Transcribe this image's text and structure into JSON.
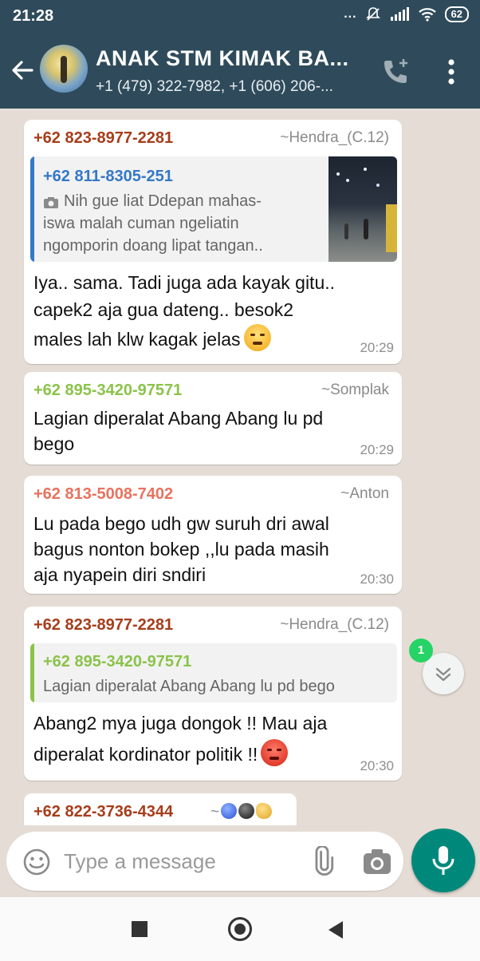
{
  "status_bar": {
    "time": "21:28",
    "signal_dots": "...",
    "battery": "62",
    "icons": [
      "mute-icon",
      "signal-icon",
      "wifi-icon",
      "battery-icon"
    ]
  },
  "header": {
    "title": "ANAK STM KIMAK BA...",
    "subtitle": "+1 (479) 322-7982, +1 (606) 206-...",
    "icons": [
      "back-arrow-icon",
      "group-avatar",
      "add-call-icon",
      "more-vert-icon"
    ]
  },
  "messages": [
    {
      "sender": "+62 823-8977-2281",
      "sender_color": "#a63d1b",
      "push_name": "~Hendra_(C.12)",
      "quote": {
        "sender": "+62 811-8305-251",
        "sender_color": "#3478c6",
        "lines": [
          "Nih gue liat Ddepan mahas-",
          "iswa malah cuman ngeliatin",
          "ngomporin doang lipat tangan.."
        ],
        "icon": "camera-icon",
        "has_thumbnail": true
      },
      "lines": [
        "Iya.. sama. Tadi juga ada kayak gitu..",
        "capek2 aja gua dateng.. besok2",
        "males lah klw kagak jelas"
      ],
      "emoji": "face-with-steam-emoji",
      "time": "20:29"
    },
    {
      "sender": "+62 895-3420-97571",
      "sender_color": "#8bc34a",
      "push_name": "~Somplak",
      "lines": [
        "Lagian diperalat Abang Abang lu pd",
        "bego"
      ],
      "time": "20:29"
    },
    {
      "sender": "+62 813-5008-7402",
      "sender_color": "#e8725e",
      "push_name": "~Anton",
      "lines": [
        "Lu pada bego udh gw suruh dri awal",
        "bagus nonton bokep ,,lu pada masih",
        "aja nyapein diri sndiri"
      ],
      "time": "20:30"
    },
    {
      "sender": "+62 823-8977-2281",
      "sender_color": "#a63d1b",
      "push_name": "~Hendra_(C.12)",
      "quote": {
        "sender": "+62 895-3420-97571",
        "sender_color": "#8bc34a",
        "lines": [
          "Lagian diperalat Abang Abang lu pd bego"
        ]
      },
      "lines": [
        "Abang2 mya juga dongok !! Mau aja",
        "diperalat kordinator politik !!"
      ],
      "emoji": "pouting-face-emoji",
      "time": "20:30"
    },
    {
      "sender": "+62 822-3736-4344",
      "sender_color": "#a63d1b",
      "push_name": "~",
      "push_emojis": [
        "blue-circle-emoji",
        "black-circle-emoji",
        "clapping-hands-emoji"
      ]
    }
  ],
  "unread_count": "1",
  "input": {
    "placeholder": "Type a message",
    "value": ""
  },
  "colors": {
    "header_bg": "#2f4b5b",
    "chat_bg": "#e5ddd5",
    "bubble_bg": "#ffffff",
    "mic_button": "#00897b",
    "unread_badge": "#25d366"
  }
}
